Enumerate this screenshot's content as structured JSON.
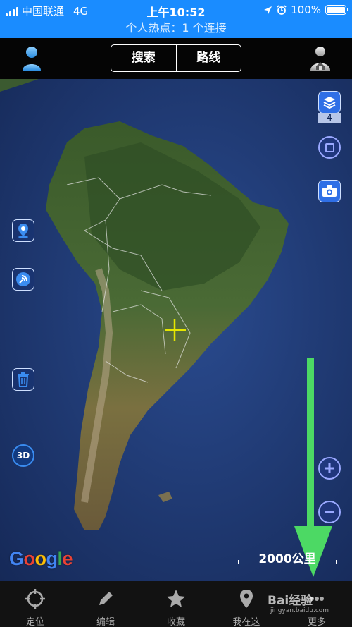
{
  "status_bar": {
    "carrier": "中国联通",
    "network": "4G",
    "time": "上午10:52",
    "battery": "100%",
    "battery_level": 1.0
  },
  "hotspot": {
    "text": "个人热点：1 个连接"
  },
  "nav": {
    "search_label": "搜索",
    "route_label": "路线",
    "user_icon": "user-icon",
    "home_icon": "home-user-icon"
  },
  "map": {
    "layer_count": "4",
    "attribution": "Google",
    "scale_label": "2000公里",
    "tools_left": [
      "location-pin-icon",
      "satellite-icon",
      "trash-icon",
      "3d-icon"
    ],
    "tools_right": [
      "layers-icon",
      "square-icon",
      "camera-icon",
      "zoom-in-icon",
      "zoom-out-icon"
    ],
    "annotation_color": "#4cd964",
    "crosshair_color": "#e6e600"
  },
  "tabs": [
    {
      "label": "定位",
      "icon": "crosshair-icon"
    },
    {
      "label": "编辑",
      "icon": "pencil-icon"
    },
    {
      "label": "收藏",
      "icon": "star-icon"
    },
    {
      "label": "我在这",
      "icon": "pin-icon"
    },
    {
      "label": "更多",
      "icon": "more-icon"
    }
  ],
  "watermark": {
    "text": "Bai经验",
    "url": "jingyan.baidu.com"
  }
}
